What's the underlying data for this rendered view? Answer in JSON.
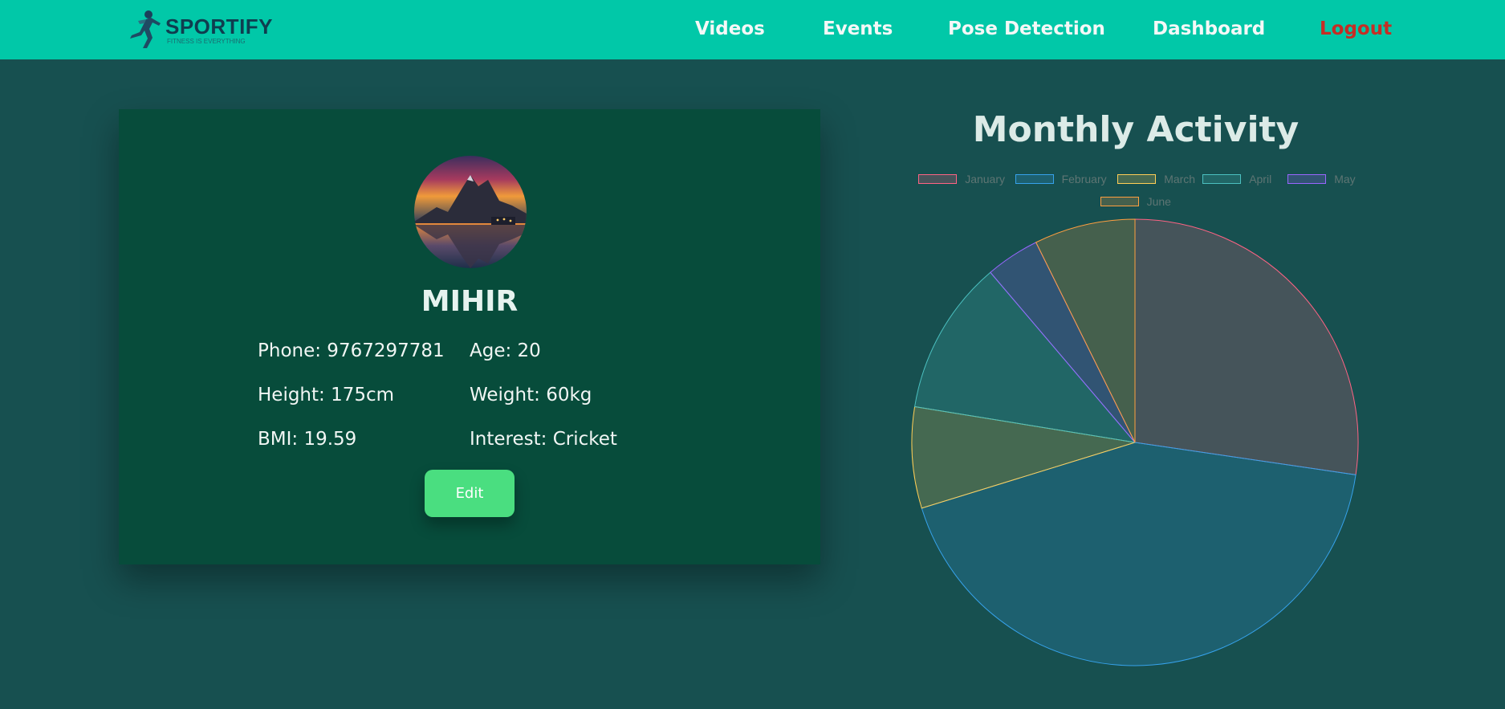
{
  "brand": {
    "name": "SPORTIFY",
    "tagline": "FITNESS IS EVERYTHING"
  },
  "nav": {
    "links": [
      "Videos",
      "Events",
      "Pose Detection",
      "Dashboard"
    ],
    "logout": "Logout"
  },
  "profile": {
    "name": "MIHIR",
    "phone": "Phone: 9767297781",
    "age": "Age: 20",
    "height": "Height: 175cm",
    "weight": "Weight: 60kg",
    "bmi": "BMI: 19.59",
    "interest": "Interest: Cricket",
    "edit_label": "Edit"
  },
  "colors": {
    "navbar": "#01c8a8",
    "background": "#175050",
    "card": "#074c3b",
    "logout": "#c62d24",
    "edit_button": "#4ade80"
  },
  "chart_data": {
    "type": "pie",
    "title": "Monthly Activity",
    "legend_position": "top",
    "labels": [
      "January",
      "February",
      "March",
      "April",
      "May",
      "June"
    ],
    "values": [
      28,
      44,
      7.5,
      11.5,
      4,
      7.5
    ],
    "colors": [
      "#ff6384",
      "#36a2eb",
      "#ffce56",
      "#4bc0c0",
      "#9966ff",
      "#ff9f40"
    ]
  }
}
